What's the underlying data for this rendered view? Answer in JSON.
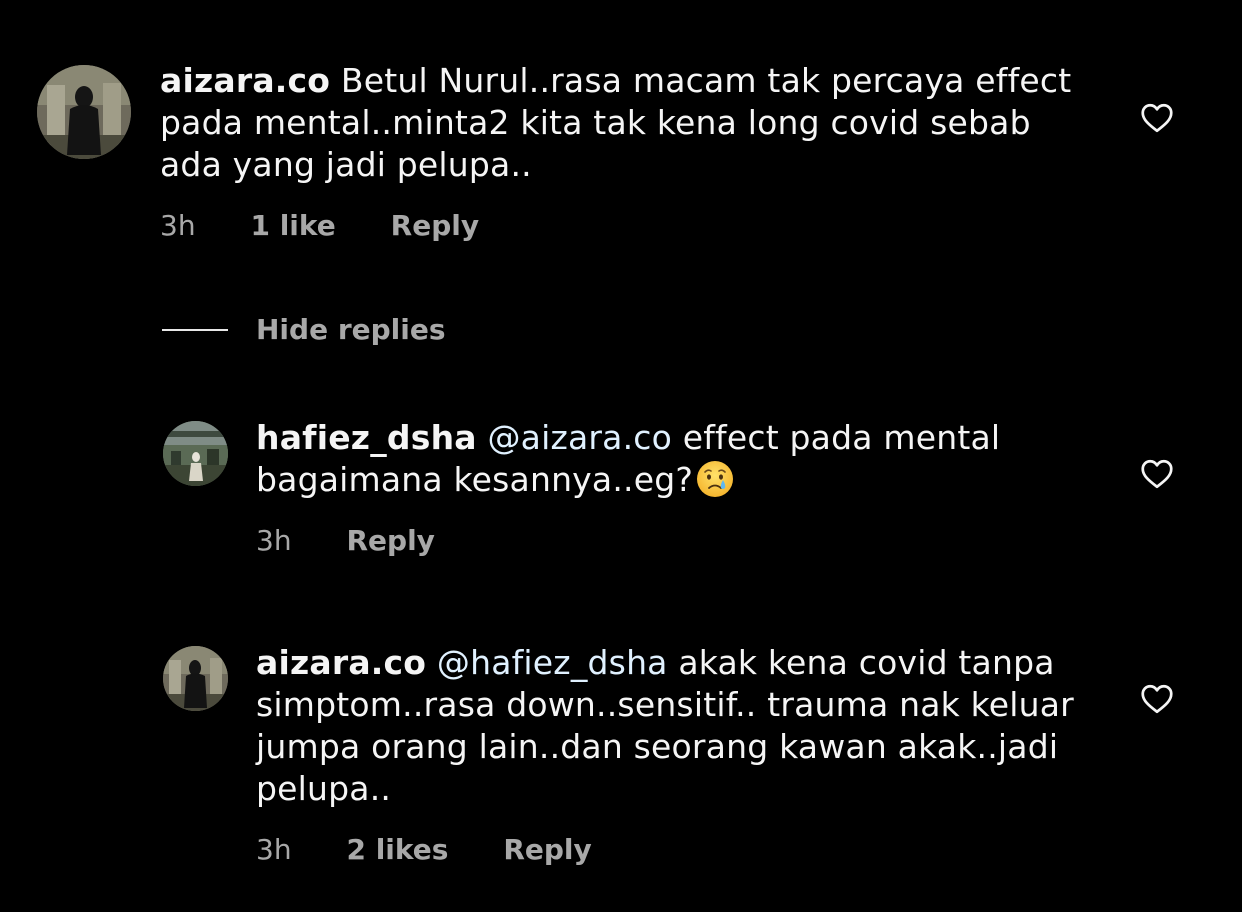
{
  "comments": [
    {
      "username": "aizara.co",
      "mention": "",
      "text_lines": [
        "Betul Nurul..rasa macam tak percaya effect",
        "pada mental..minta2 kita tak kena long covid sebab",
        "ada yang jadi pelupa.."
      ],
      "time": "3h",
      "likes": "1 like",
      "reply_label": "Reply"
    },
    {
      "username": "hafiez_dsha",
      "mention": "@aizara.co",
      "text_first": "effect pada mental",
      "text_second": "bagaimana kesannya..eg?",
      "emoji": "crying-face-emoji",
      "time": "3h",
      "reply_label": "Reply"
    },
    {
      "username": "aizara.co",
      "mention": "@hafiez_dsha",
      "text_first": "akak kena covid tanpa",
      "text_lines_rest": [
        "simptom..rasa down..sensitif.. trauma nak keluar",
        "jumpa orang lain..dan seorang kawan akak..jadi",
        "pelupa.."
      ],
      "time": "3h",
      "likes": "2 likes",
      "reply_label": "Reply"
    }
  ],
  "hide_replies_label": "Hide replies",
  "icons": {
    "like": "heart-outline-icon"
  },
  "colors": {
    "background": "#000000",
    "text": "#f5f5f5",
    "meta": "#a8a8a8",
    "mention": "#e0f1ff"
  }
}
